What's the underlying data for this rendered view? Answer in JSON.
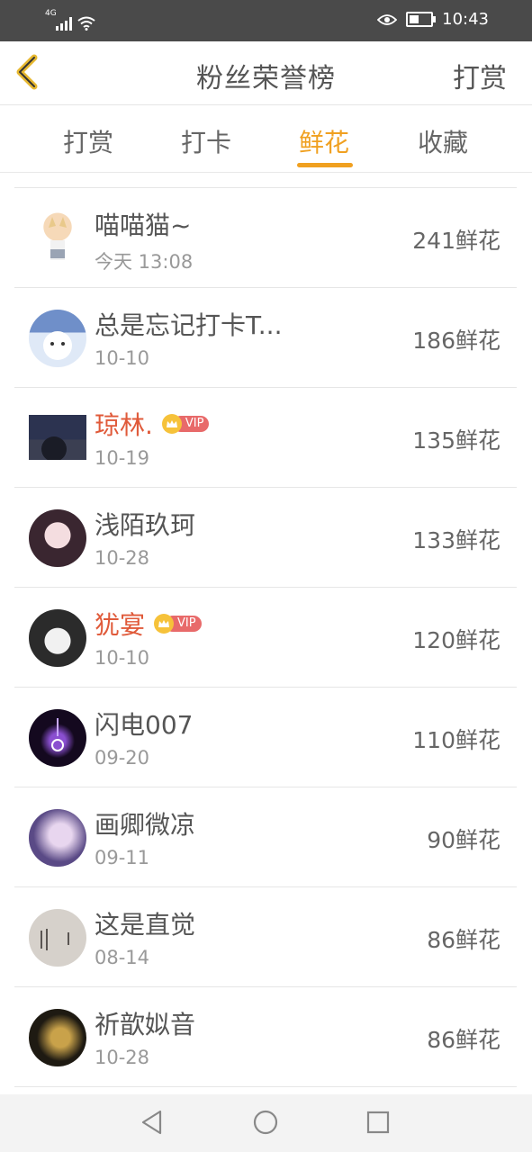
{
  "status_bar": {
    "network": "4G",
    "time": "10:43",
    "battery_level": 0.45,
    "icons": [
      "signal-icon",
      "wifi-icon",
      "eye-icon",
      "battery-icon"
    ]
  },
  "header": {
    "title": "粉丝荣誉榜",
    "action_label": "打赏",
    "back_icon": "chevron-left-icon"
  },
  "tabs": [
    {
      "label": "打赏",
      "active": false
    },
    {
      "label": "打卡",
      "active": false
    },
    {
      "label": "鲜花",
      "active": true
    },
    {
      "label": "收藏",
      "active": false
    }
  ],
  "colors": {
    "accent": "#f0a020",
    "vip_name": "#e05a3a",
    "vip_badge": "#e86a6a",
    "crown": "#f6c23a"
  },
  "vip_label": "VIP",
  "fans": [
    {
      "name": "喵喵猫~",
      "date": "今天 13:08",
      "amount": "241鲜花",
      "vip": false
    },
    {
      "name": "总是忘记打卡T...",
      "date": "10-10",
      "amount": "186鲜花",
      "vip": false
    },
    {
      "name": "琼林.",
      "date": "10-19",
      "amount": "135鲜花",
      "vip": true
    },
    {
      "name": "浅陌玖珂",
      "date": "10-28",
      "amount": "133鲜花",
      "vip": false
    },
    {
      "name": "犹宴",
      "date": "10-10",
      "amount": "120鲜花",
      "vip": true
    },
    {
      "name": "闪电007",
      "date": "09-20",
      "amount": "110鲜花",
      "vip": false
    },
    {
      "name": "画卿微凉",
      "date": "09-11",
      "amount": "90鲜花",
      "vip": false
    },
    {
      "name": "这是直觉",
      "date": "08-14",
      "amount": "86鲜花",
      "vip": false
    },
    {
      "name": "祈歆姒音",
      "date": "10-28",
      "amount": "86鲜花",
      "vip": false
    }
  ],
  "nav": [
    "back-triangle-icon",
    "home-circle-icon",
    "recent-square-icon"
  ]
}
